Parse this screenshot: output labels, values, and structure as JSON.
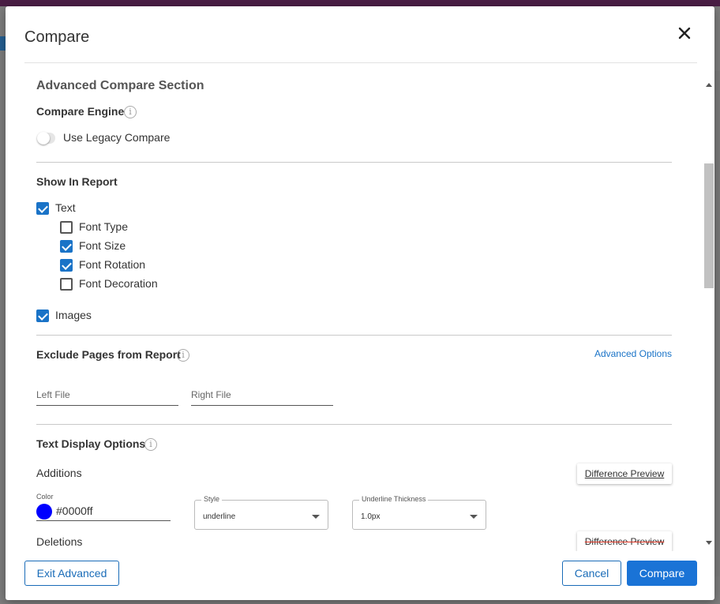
{
  "dialog": {
    "title": "Compare"
  },
  "advanced_section": {
    "title": "Advanced Compare Section",
    "engine_label": "Compare Engine",
    "legacy_toggle_label": "Use Legacy Compare",
    "legacy_toggle_on": false
  },
  "show_in_report": {
    "label": "Show In Report",
    "text": {
      "label": "Text",
      "checked": true
    },
    "font_type": {
      "label": "Font Type",
      "checked": false
    },
    "font_size": {
      "label": "Font Size",
      "checked": true
    },
    "font_rotation": {
      "label": "Font Rotation",
      "checked": true
    },
    "font_decoration": {
      "label": "Font Decoration",
      "checked": false
    },
    "images": {
      "label": "Images",
      "checked": true
    }
  },
  "exclude_pages": {
    "label": "Exclude Pages from Report",
    "advanced_link": "Advanced Options",
    "left_placeholder": "Left File",
    "right_placeholder": "Right File"
  },
  "text_display": {
    "label": "Text Display Options",
    "additions": {
      "label": "Additions",
      "preview": "Difference Preview",
      "color_label": "Color",
      "color_value": "#0000ff",
      "style_label": "Style",
      "style_value": "underline",
      "thickness_label": "Underline Thickness",
      "thickness_value": "1.0px"
    },
    "deletions": {
      "label": "Deletions",
      "preview": "Difference Preview"
    }
  },
  "footer": {
    "exit_advanced": "Exit Advanced",
    "cancel": "Cancel",
    "compare": "Compare"
  },
  "colors": {
    "accent": "#1a73d6",
    "checkbox": "#1a73c7",
    "addition_color": "#0000ff",
    "deletion_strike": "#dd3322"
  }
}
